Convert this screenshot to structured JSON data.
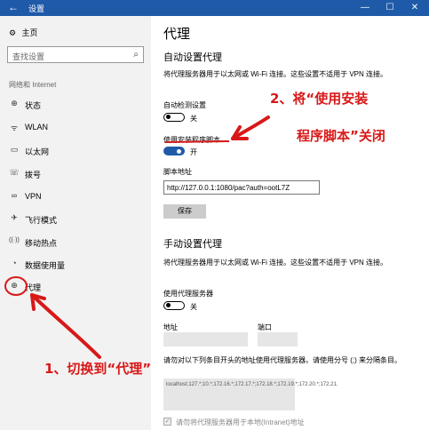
{
  "titlebar": {
    "back_icon": "back-arrow-icon",
    "title": "设置",
    "minimize": "—",
    "maximize": "☐",
    "close": "✕"
  },
  "sidebar": {
    "home_label": "主页",
    "search_placeholder": "查找设置",
    "section_label": "网络和 Internet",
    "items": [
      {
        "icon": "status-icon",
        "glyph": "⊕",
        "label": "状态"
      },
      {
        "icon": "wlan-icon",
        "glyph": "ᯤ",
        "label": "WLAN"
      },
      {
        "icon": "ethernet-icon",
        "glyph": "▭",
        "label": "以太网"
      },
      {
        "icon": "dialup-icon",
        "glyph": "☏",
        "label": "拨号"
      },
      {
        "icon": "vpn-icon",
        "glyph": "∞",
        "label": "VPN"
      },
      {
        "icon": "airplane-icon",
        "glyph": "✈",
        "label": "飞行模式"
      },
      {
        "icon": "hotspot-icon",
        "glyph": "((·))",
        "label": "移动热点"
      },
      {
        "icon": "data-usage-icon",
        "glyph": "◔",
        "label": "数据使用量"
      },
      {
        "icon": "proxy-icon",
        "glyph": "⊕",
        "label": "代理"
      }
    ]
  },
  "main": {
    "title": "代理",
    "auto": {
      "heading": "自动设置代理",
      "description": "将代理服务器用于以太网或 Wi-Fi 连接。这些设置不适用于 VPN 连接。",
      "detect_label": "自动检测设置",
      "detect_state": "关",
      "script_label": "使用安装程序脚本",
      "script_state": "开",
      "address_label": "脚本地址",
      "address_value": "http://127.0.0.1:1080/pac?auth=ootL7Z",
      "save_label": "保存"
    },
    "manual": {
      "heading": "手动设置代理",
      "description": "将代理服务器用于以太网或 Wi-Fi 连接。这些设置不适用于 VPN 连接。",
      "use_proxy_label": "使用代理服务器",
      "use_proxy_state": "关",
      "address_label": "地址",
      "port_label": "端口",
      "exceptions_desc": "请勿对以下列条目开头的地址使用代理服务器。请使用分号 (;) 来分隔条目。",
      "exceptions_value": "localhost;127.*;10.*;172.16.*;172.17.*;172.18.*;172.19.*;172.20.*;172.21.",
      "local_checkbox_label": "请勿将代理服务器用于本地(Intranet)地址"
    }
  },
  "annotations": {
    "step2_line1": "2、将“使用安装",
    "step2_line2": "程序脚本”关闭",
    "step1": "1、切换到“代理”"
  },
  "colors": {
    "accent": "#1f5aa8",
    "annotation": "#d81818"
  }
}
